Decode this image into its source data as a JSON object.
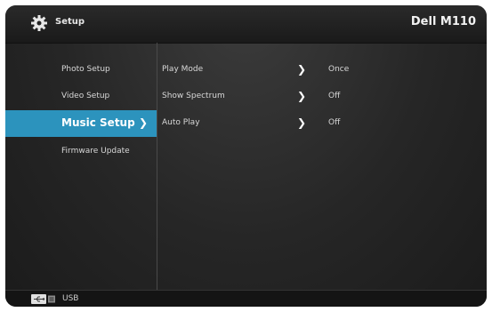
{
  "header": {
    "title": "Setup",
    "brand": "Dell M110",
    "icon": "gear-icon"
  },
  "sidebar": {
    "items": [
      {
        "label": "Photo Setup"
      },
      {
        "label": "Video Setup"
      },
      {
        "label": "Music Setup",
        "selected": true
      },
      {
        "label": "Firmware Update"
      }
    ]
  },
  "settings": {
    "rows": [
      {
        "label": "Play Mode",
        "value": "Once"
      },
      {
        "label": "Show Spectrum",
        "value": "Off"
      },
      {
        "label": "Auto Play",
        "value": "Off"
      }
    ]
  },
  "footer": {
    "source_label": "USB",
    "icon": "usb-icon"
  },
  "colors": {
    "accent": "#2c93bd"
  }
}
